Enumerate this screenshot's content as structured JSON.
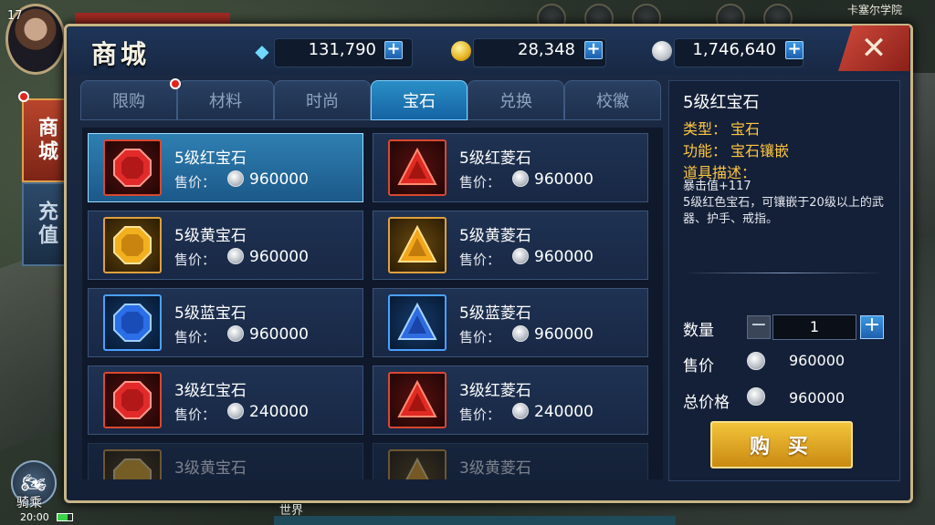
{
  "hud": {
    "level": "17",
    "map_name": "卡塞尔学院",
    "mount_label": "骑乘",
    "time": "20:00",
    "world_label": "世界"
  },
  "side_tabs": [
    {
      "label": "商城",
      "active": true
    },
    {
      "label": "充值",
      "active": false
    }
  ],
  "shop": {
    "title": "商城",
    "currencies": [
      {
        "icon": "diamond-icon",
        "value": "131,790"
      },
      {
        "icon": "gold-coin-icon",
        "value": "28,348"
      },
      {
        "icon": "silver-coin-icon",
        "value": "1,746,640"
      }
    ],
    "close_symbol": "✕",
    "tabs": [
      {
        "label": "限购",
        "badge": true
      },
      {
        "label": "材料",
        "badge": false
      },
      {
        "label": "时尚",
        "badge": false
      },
      {
        "label": "宝石",
        "badge": false,
        "active": true
      },
      {
        "label": "兑换",
        "badge": false
      },
      {
        "label": "校徽",
        "badge": false
      }
    ],
    "items": [
      {
        "name": "5级红宝石",
        "price_label": "售价：",
        "price": "960000",
        "gem": "red-ruby",
        "selected": true
      },
      {
        "name": "5级红菱石",
        "price_label": "售价：",
        "price": "960000",
        "gem": "red-triangle"
      },
      {
        "name": "5级黄宝石",
        "price_label": "售价：",
        "price": "960000",
        "gem": "yellow-ruby"
      },
      {
        "name": "5级黄菱石",
        "price_label": "售价：",
        "price": "960000",
        "gem": "yellow-triangle"
      },
      {
        "name": "5级蓝宝石",
        "price_label": "售价：",
        "price": "960000",
        "gem": "blue-ruby"
      },
      {
        "name": "5级蓝菱石",
        "price_label": "售价：",
        "price": "960000",
        "gem": "blue-triangle"
      },
      {
        "name": "3级红宝石",
        "price_label": "售价：",
        "price": "240000",
        "gem": "red-ruby"
      },
      {
        "name": "3级红菱石",
        "price_label": "售价：",
        "price": "240000",
        "gem": "red-triangle"
      },
      {
        "name": "3级黄宝石",
        "price_label": "",
        "price": "",
        "gem": "yellow-ruby",
        "partial": true
      },
      {
        "name": "3级黄菱石",
        "price_label": "",
        "price": "",
        "gem": "yellow-triangle",
        "partial": true
      }
    ]
  },
  "detail": {
    "title": "5级红宝石",
    "type_label": "类型：",
    "type_value": "宝石",
    "function_label": "功能：",
    "function_value": "宝石镶嵌",
    "desc_label": "道具描述：",
    "desc_line1": "暴击值+117",
    "desc_line2": "5级红色宝石，可镶嵌于20级以上的武器、护手、戒指。",
    "qty_label": "数量",
    "qty_value": "1",
    "price_label": "售价",
    "price_value": "960000",
    "total_label": "总价格",
    "total_value": "960000",
    "buy_label": "购 买"
  },
  "colors": {
    "accent": "#2a8fc6",
    "gold": "#ffc640",
    "close_red": "#d14a3c"
  }
}
